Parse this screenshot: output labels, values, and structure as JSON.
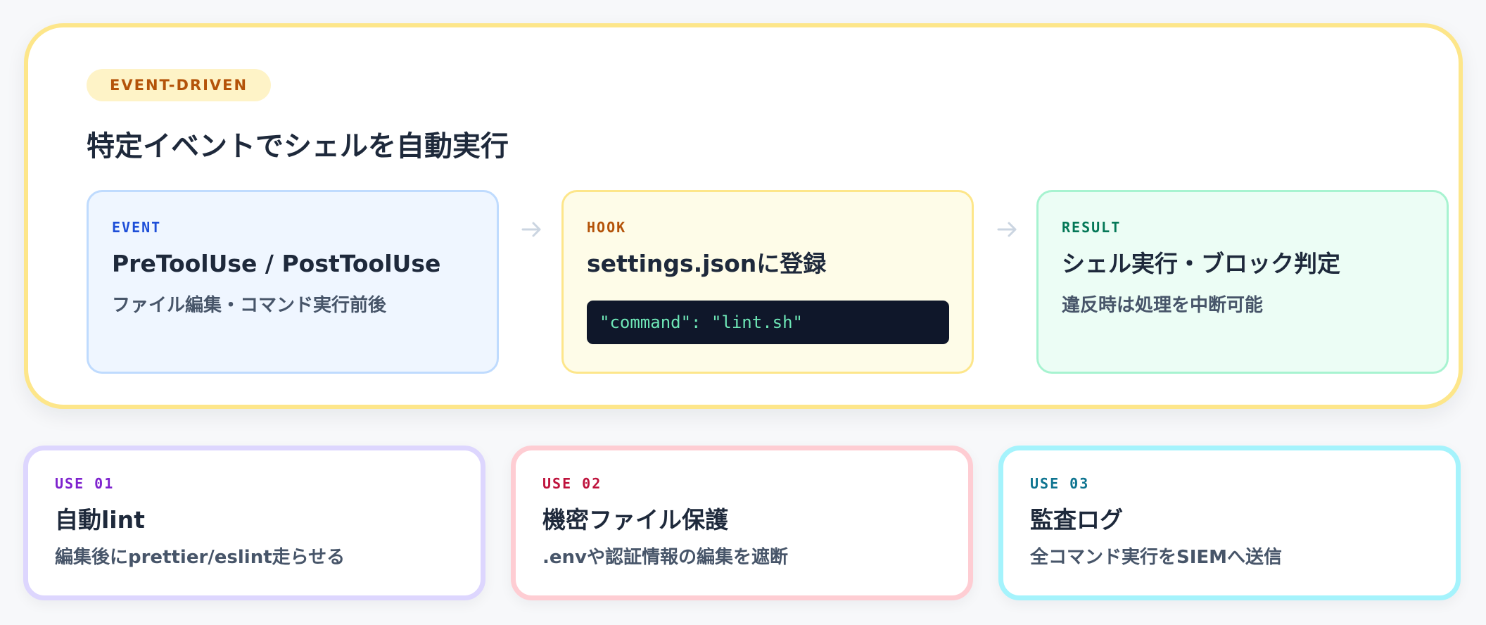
{
  "hero": {
    "badge": "EVENT-DRIVEN",
    "title": "特定イベントでシェルを自動実行"
  },
  "steps": [
    {
      "tag": "EVENT",
      "title": "PreToolUse / PostToolUse",
      "desc": "ファイル編集・コマンド実行前後"
    },
    {
      "tag": "HOOK",
      "title": "settings.jsonに登録",
      "code": "\"command\": \"lint.sh\""
    },
    {
      "tag": "RESULT",
      "title": "シェル実行・ブロック判定",
      "desc": "違反時は処理を中断可能"
    }
  ],
  "uses": [
    {
      "tag": "USE 01",
      "title": "自動lint",
      "desc": "編集後にprettier/eslint走らせる"
    },
    {
      "tag": "USE 02",
      "title": "機密ファイル保護",
      "desc": ".envや認証情報の編集を遮断"
    },
    {
      "tag": "USE 03",
      "title": "監査ログ",
      "desc": "全コマンド実行をSIEMへ送信"
    }
  ],
  "colors": {
    "hero_border": "#fde68a",
    "event_accent": "#1d4ed8",
    "hook_accent": "#b45309",
    "result_accent": "#047857",
    "use1_accent": "#7e22ce",
    "use2_accent": "#be123c",
    "use3_accent": "#0e7490",
    "code_bg": "#0f172a",
    "code_text": "#6ee7b7"
  },
  "icons": {
    "flow_arrow": "arrow-right-icon"
  }
}
